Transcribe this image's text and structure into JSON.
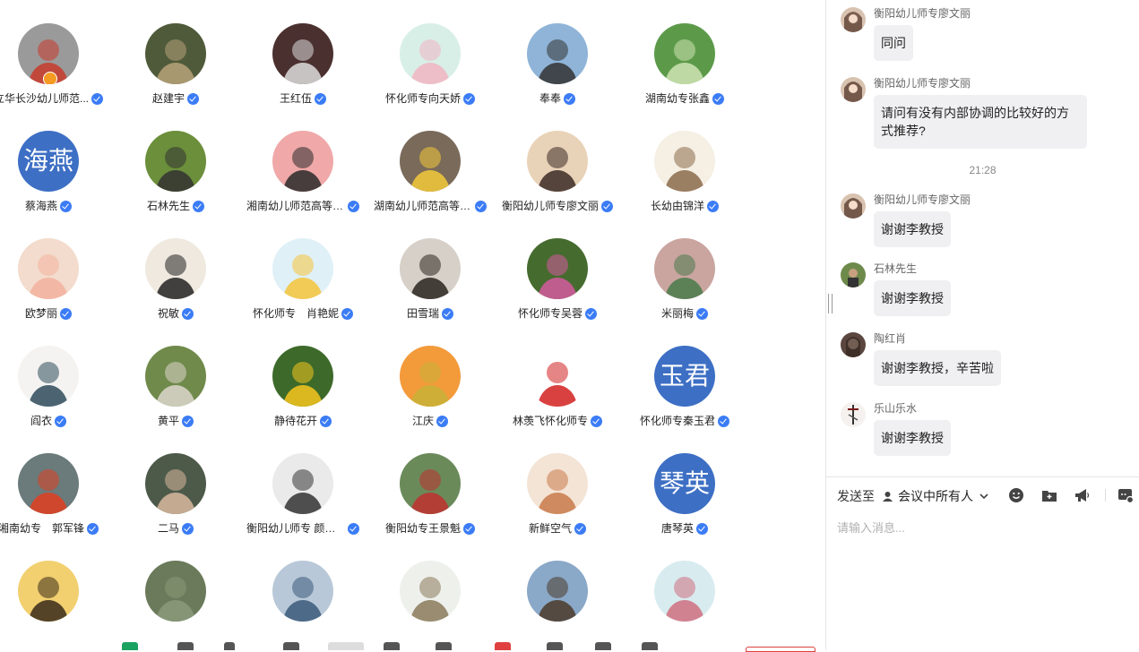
{
  "participants": [
    {
      "name": "立华长沙幼儿师范...",
      "host": true
    },
    {
      "name": "赵建宇"
    },
    {
      "name": "王红伍"
    },
    {
      "name": "怀化师专向天娇"
    },
    {
      "name": "奉奉"
    },
    {
      "name": "湖南幼专张鑫"
    },
    {
      "name": "蔡海燕",
      "avatar_text": "海燕"
    },
    {
      "name": "石林先生"
    },
    {
      "name": "湘南幼儿师范高等专..."
    },
    {
      "name": "湖南幼儿师范高等专..."
    },
    {
      "name": "衡阳幼儿师专廖文丽"
    },
    {
      "name": "长幼由锦洋"
    },
    {
      "name": "欧梦丽"
    },
    {
      "name": "祝敏"
    },
    {
      "name": "怀化师专　肖艳妮"
    },
    {
      "name": "田雪瑞"
    },
    {
      "name": "怀化师专吴蓉"
    },
    {
      "name": "米丽梅"
    },
    {
      "name": "阎衣"
    },
    {
      "name": "黄平"
    },
    {
      "name": "静待花开"
    },
    {
      "name": "江庆"
    },
    {
      "name": "林羡飞怀化师专"
    },
    {
      "name": "怀化师专秦玉君",
      "avatar_text": "玉君"
    },
    {
      "name": "湘南幼专　郭军锋"
    },
    {
      "name": "二马"
    },
    {
      "name": "衡阳幼儿师专 颜文剑"
    },
    {
      "name": "衡阳幼专王景魁"
    },
    {
      "name": "新鲜空气"
    },
    {
      "name": "唐琴英",
      "avatar_text": "琴英"
    },
    {
      "name": ""
    },
    {
      "name": ""
    },
    {
      "name": ""
    },
    {
      "name": ""
    },
    {
      "name": ""
    },
    {
      "name": ""
    }
  ],
  "chat": {
    "timestamp": "21:28",
    "messages": [
      {
        "sender": "衡阳幼儿师专廖文丽",
        "text": "同问"
      },
      {
        "sender": "衡阳幼儿师专廖文丽",
        "text": "请问有没有内部协调的比较好的方式推荐?"
      },
      {
        "sender": "衡阳幼儿师专廖文丽",
        "text": "谢谢李教授"
      },
      {
        "sender": "石林先生",
        "text": "谢谢李教授"
      },
      {
        "sender": "陶红肖",
        "text": "谢谢李教授，辛苦啦"
      },
      {
        "sender": "乐山乐水",
        "text": "谢谢李教授"
      }
    ]
  },
  "composer": {
    "send_to_label": "发送至",
    "recipient": "会议中所有人",
    "placeholder": "请输入消息..."
  },
  "colors": {
    "accent": "#3b7cf6",
    "avatar_text_bg": "#3d6fc4",
    "bubble_bg": "#f0f0f2",
    "host_badge": "#f59a23"
  },
  "icons": {
    "verified": "verified-badge-icon",
    "emoji": "emoji-icon",
    "folder": "folder-icon",
    "announce": "megaphone-icon",
    "more": "chat-settings-icon"
  }
}
